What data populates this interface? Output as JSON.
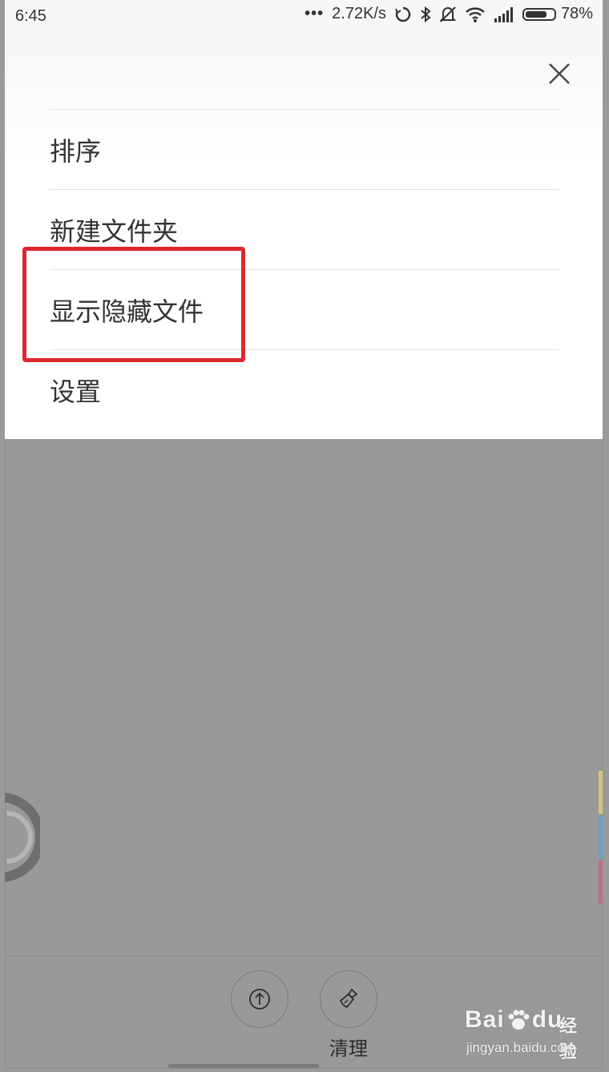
{
  "status_bar": {
    "time": "6:45",
    "dots": "•••",
    "speed": "2.72K/s",
    "battery": "78%",
    "battery_level": 0.78,
    "icons": [
      "sync-icon",
      "bluetooth-icon",
      "mute-icon",
      "wifi-icon",
      "signal-icon",
      "battery-icon"
    ]
  },
  "menu": {
    "close_icon": "close-icon",
    "items": [
      {
        "label": "排序"
      },
      {
        "label": "新建文件夹"
      },
      {
        "label": "显示隐藏文件"
      },
      {
        "label": "设置"
      }
    ]
  },
  "toolbar": {
    "items": [
      {
        "icon": "upload-icon",
        "label": ""
      },
      {
        "icon": "broom-icon",
        "label": "清理"
      }
    ]
  },
  "watermark": {
    "brand_left": "Bai",
    "brand_right": "du",
    "sub": "经验",
    "url": "jingyan.baidu.com"
  },
  "colors": {
    "highlight": "#e0262d",
    "overlay": "#999999",
    "edge_tabs": [
      "#d8c27a",
      "#6f9fc8",
      "#c46b87"
    ]
  }
}
